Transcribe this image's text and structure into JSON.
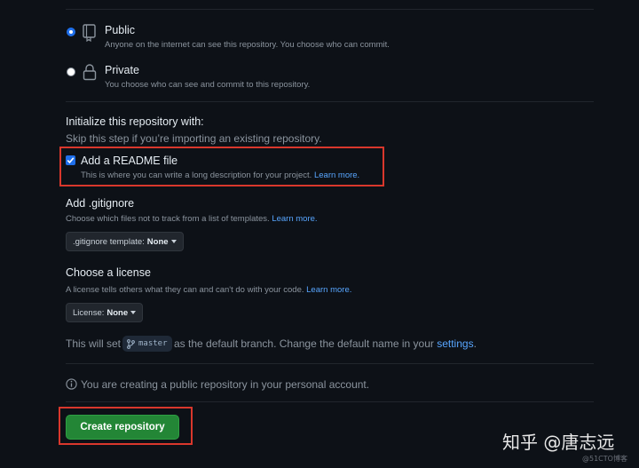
{
  "visibility": {
    "public": {
      "title": "Public",
      "description": "Anyone on the internet can see this repository. You choose who can commit.",
      "selected": true,
      "icon": "repo-icon"
    },
    "private": {
      "title": "Private",
      "description": "You choose who can see and commit to this repository.",
      "selected": false,
      "icon": "lock-icon"
    }
  },
  "initialize": {
    "title": "Initialize this repository with:",
    "subtitle": "Skip this step if you’re importing an existing repository."
  },
  "readme": {
    "label": "Add a README file",
    "description": "This is where you can write a long description for your project.",
    "link": "Learn more.",
    "checked": true
  },
  "gitignore": {
    "title": "Add .gitignore",
    "description": "Choose which files not to track from a list of templates.",
    "link": "Learn more.",
    "dropdown_label": ".gitignore template:",
    "dropdown_value": "None"
  },
  "license": {
    "title": "Choose a license",
    "description": "A license tells others what they can and can't do with your code.",
    "link": "Learn more.",
    "dropdown_label": "License:",
    "dropdown_value": "None"
  },
  "branch": {
    "prefix": "This will set",
    "name": "master",
    "suffix": "as the default branch. Change the default name in your",
    "link": "settings",
    "end": "."
  },
  "notice": {
    "text": "You are creating a public repository in your personal account."
  },
  "create_button": {
    "label": "Create repository"
  },
  "watermark": {
    "main": "知乎 @唐志远",
    "small": "@51CTO博客"
  },
  "colors": {
    "background": "#0d1117",
    "accent": "#1f6feb",
    "button": "#238636",
    "link": "#58a6ff",
    "highlight": "#d9372c"
  }
}
